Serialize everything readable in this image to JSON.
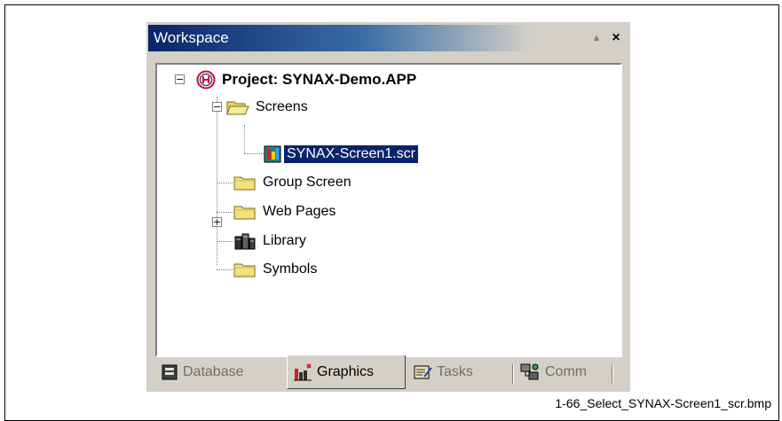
{
  "workspace": {
    "title": "Workspace",
    "pin_glyph": "▲",
    "close_glyph": "×"
  },
  "tree": {
    "project": {
      "label": "Project: SYNAX-Demo.APP",
      "icon": "project-icon",
      "expanded": true
    },
    "screens": {
      "label": "Screens",
      "icon": "folder-open-icon",
      "expanded": true
    },
    "screen1": {
      "label": "SYNAX-Screen1.scr",
      "icon": "screen-file-icon",
      "selected": true
    },
    "group_screen": {
      "label": "Group Screen",
      "icon": "folder-icon"
    },
    "web_pages": {
      "label": "Web Pages",
      "icon": "folder-icon",
      "expanded": false
    },
    "library": {
      "label": "Library",
      "icon": "library-icon"
    },
    "symbols": {
      "label": "Symbols",
      "icon": "folder-icon"
    }
  },
  "tabs": [
    {
      "label": "Database",
      "icon": "database-icon",
      "active": false
    },
    {
      "label": "Graphics",
      "icon": "graphics-icon",
      "active": true
    },
    {
      "label": "Tasks",
      "icon": "tasks-icon",
      "active": false
    },
    {
      "label": "Comm",
      "icon": "comm-icon",
      "active": false
    }
  ],
  "caption": "1-66_Select_SYNAX-Screen1_scr.bmp",
  "colors": {
    "title_gradient_start": "#0a246a",
    "selection": "#0a246a",
    "folder": "#f2e27a",
    "panel": "#d4d0c8"
  }
}
